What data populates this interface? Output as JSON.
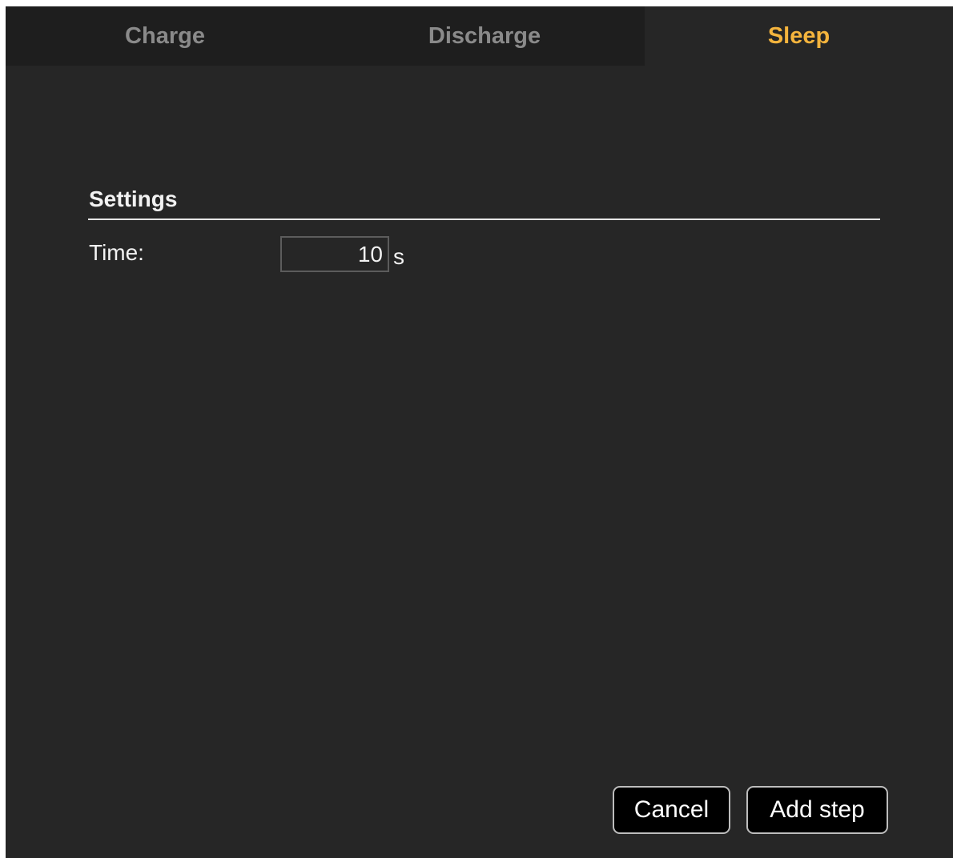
{
  "tabs": [
    {
      "label": "Charge",
      "active": false
    },
    {
      "label": "Discharge",
      "active": false
    },
    {
      "label": "Sleep",
      "active": true
    }
  ],
  "settings": {
    "title": "Settings",
    "time_label": "Time:",
    "time_value": "10",
    "time_unit": "s"
  },
  "actions": {
    "cancel_label": "Cancel",
    "add_step_label": "Add step"
  },
  "colors": {
    "panel_background": "#262626",
    "inactive_tab_background": "#1e1e1e",
    "active_tab_text": "#f4b43d",
    "inactive_tab_text": "#8a8a8a",
    "button_background": "#000000"
  }
}
